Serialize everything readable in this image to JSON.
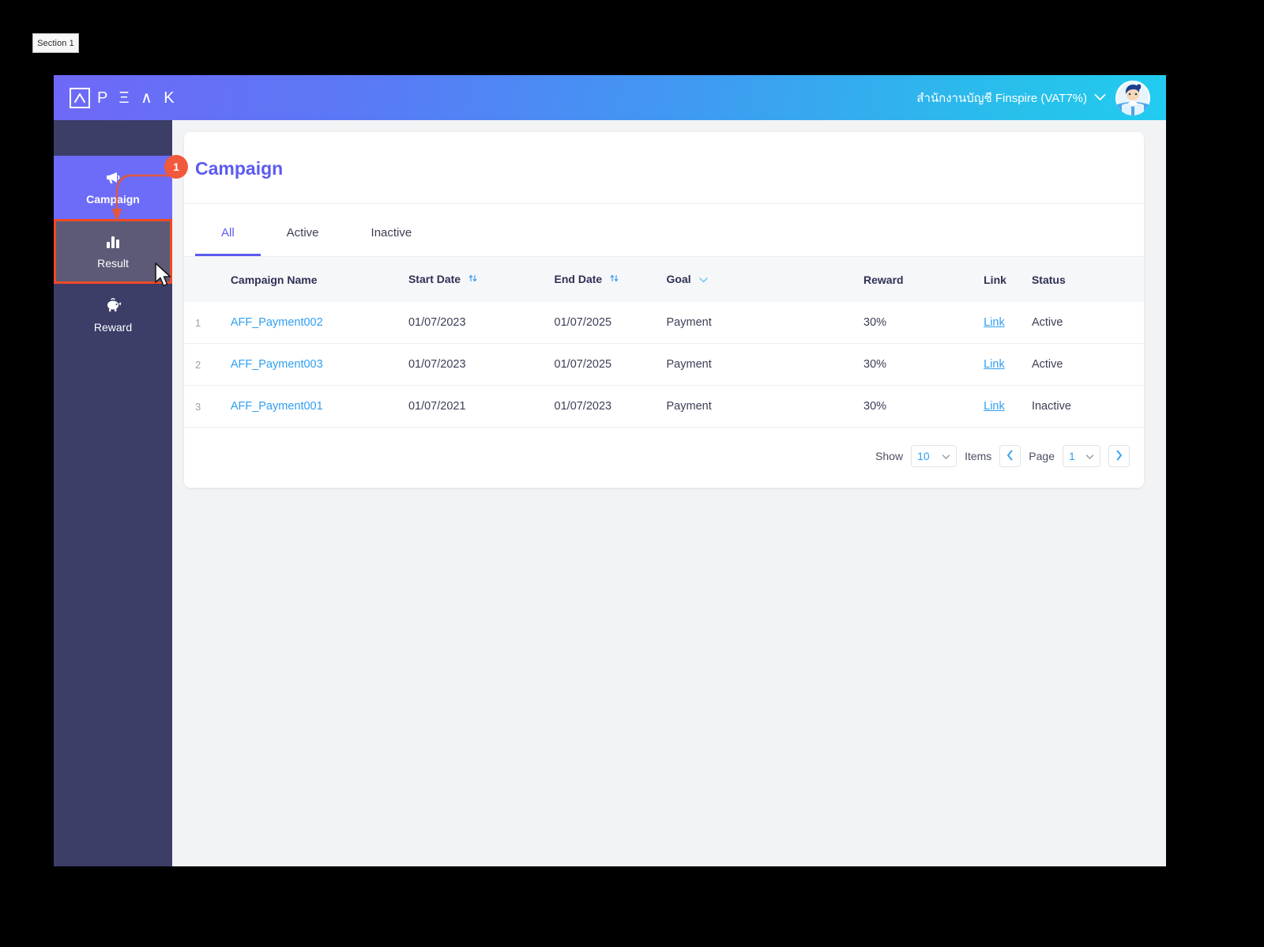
{
  "annotation": {
    "section_tag": "Section 1",
    "badge_number": "1",
    "highlight_color": "#f04a24",
    "badge_color": "#f2593c"
  },
  "topbar": {
    "logo_text": "P Ξ ∧ K",
    "org_name": "สำนักงานบัญชี Finspire (VAT7%)",
    "chevron_icon": "chevron-down-icon",
    "avatar_icon": "user-avatar",
    "gradient_from": "#6f68f7",
    "gradient_to": "#21ccef"
  },
  "sidebar": {
    "items": [
      {
        "label": "Campaign",
        "icon": "megaphone-icon",
        "state": "active"
      },
      {
        "label": "Result",
        "icon": "bar-chart-icon",
        "state": "hovered"
      },
      {
        "label": "Reward",
        "icon": "piggy-bank-icon",
        "state": "default"
      }
    ],
    "background": "#3c3e68",
    "active_background": "#6c6cf8"
  },
  "main": {
    "page_title": "Campaign",
    "title_color": "#5b5bf0",
    "tabs": [
      {
        "label": "All",
        "active": true
      },
      {
        "label": "Active",
        "active": false
      },
      {
        "label": "Inactive",
        "active": false
      }
    ],
    "table": {
      "columns": [
        {
          "label": "",
          "icon": ""
        },
        {
          "label": "Campaign Name",
          "icon": ""
        },
        {
          "label": "Start Date",
          "icon": "sort-icon"
        },
        {
          "label": "End Date",
          "icon": "sort-icon"
        },
        {
          "label": "Goal",
          "icon": "chevron-down-icon"
        },
        {
          "label": "Reward",
          "icon": ""
        },
        {
          "label": "Link",
          "icon": ""
        },
        {
          "label": "Status",
          "icon": ""
        }
      ],
      "rows": [
        {
          "index": "1",
          "name": "AFF_Payment002",
          "start_date": "01/07/2023",
          "end_date": "01/07/2025",
          "goal": "Payment",
          "reward": "30%",
          "link": "Link",
          "status": "Active"
        },
        {
          "index": "2",
          "name": "AFF_Payment003",
          "start_date": "01/07/2023",
          "end_date": "01/07/2025",
          "goal": "Payment",
          "reward": "30%",
          "link": "Link",
          "status": "Active"
        },
        {
          "index": "3",
          "name": "AFF_Payment001",
          "start_date": "01/07/2021",
          "end_date": "01/07/2023",
          "goal": "Payment",
          "reward": "30%",
          "link": "Link",
          "status": "Inactive"
        }
      ]
    },
    "pagination": {
      "show_label": "Show",
      "show_value": "10",
      "items_label": "Items",
      "prev_icon": "chevron-left-icon",
      "page_label": "Page",
      "page_value": "1",
      "next_icon": "chevron-right-icon"
    }
  }
}
